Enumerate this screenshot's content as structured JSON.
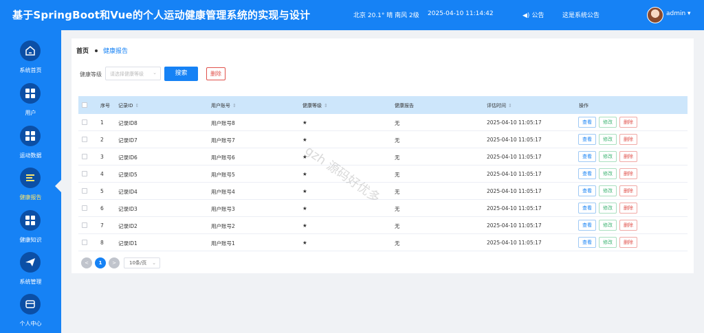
{
  "header": {
    "title": "基于SpringBoot和Vue的个人运动健康管理系统的实现与设计",
    "weather": "北京 20.1° 晴 南风 2级",
    "datetime": "2025-04-10 11:14:42",
    "notice_label": "公告",
    "logout_label": "这是系统公告",
    "username": "admin ▾"
  },
  "sidebar": {
    "items": [
      {
        "label": "系统首页",
        "icon": "home-icon"
      },
      {
        "label": "用户",
        "icon": "grid-icon"
      },
      {
        "label": "运动数据",
        "icon": "grid-icon"
      },
      {
        "label": "健康报告",
        "icon": "list-icon",
        "active": true
      },
      {
        "label": "健康知识",
        "icon": "grid-icon"
      },
      {
        "label": "系统管理",
        "icon": "send-icon"
      },
      {
        "label": "个人中心",
        "icon": "card-icon"
      }
    ]
  },
  "breadcrumb": {
    "home": "首页",
    "current": "健康报告"
  },
  "filter": {
    "label": "健康等级",
    "placeholder": "请选择健康等级",
    "search_label": "搜索",
    "delete_label": "删除"
  },
  "table": {
    "headers": {
      "index": "序号",
      "record_id": "记录ID",
      "account": "用户账号",
      "level": "健康等级",
      "report": "健康报告",
      "time": "评估时间",
      "ops": "操作"
    },
    "rows": [
      {
        "index": "1",
        "record_id": "记录ID8",
        "account": "用户账号8",
        "level": "★",
        "report": "无",
        "time": "2025-04-10 11:05:17"
      },
      {
        "index": "2",
        "record_id": "记录ID7",
        "account": "用户账号7",
        "level": "★",
        "report": "无",
        "time": "2025-04-10 11:05:17"
      },
      {
        "index": "3",
        "record_id": "记录ID6",
        "account": "用户账号6",
        "level": "★",
        "report": "无",
        "time": "2025-04-10 11:05:17"
      },
      {
        "index": "4",
        "record_id": "记录ID5",
        "account": "用户账号5",
        "level": "★",
        "report": "无",
        "time": "2025-04-10 11:05:17"
      },
      {
        "index": "5",
        "record_id": "记录ID4",
        "account": "用户账号4",
        "level": "★",
        "report": "无",
        "time": "2025-04-10 11:05:17"
      },
      {
        "index": "6",
        "record_id": "记录ID3",
        "account": "用户账号3",
        "level": "★",
        "report": "无",
        "time": "2025-04-10 11:05:17"
      },
      {
        "index": "7",
        "record_id": "记录ID2",
        "account": "用户账号2",
        "level": "★",
        "report": "无",
        "time": "2025-04-10 11:05:17"
      },
      {
        "index": "8",
        "record_id": "记录ID1",
        "account": "用户账号1",
        "level": "★",
        "report": "无",
        "time": "2025-04-10 11:05:17"
      }
    ],
    "ops": {
      "view": "查看",
      "edit": "修改",
      "delete": "删除"
    }
  },
  "pagination": {
    "prev": "<",
    "current": "1",
    "next": ">",
    "page_size": "10条/页"
  },
  "watermark": "gzh 源码好优多",
  "colors": {
    "primary": "#1682f5",
    "danger": "#e0504a",
    "success": "#3cb371",
    "header_row": "#cde6fb"
  }
}
